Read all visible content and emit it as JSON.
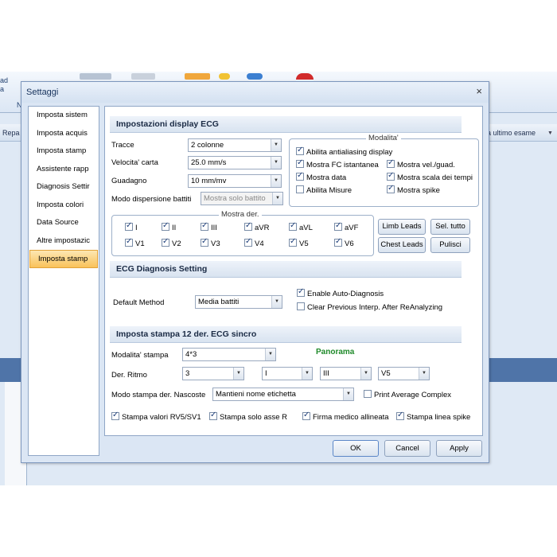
{
  "background": {
    "ribbon_left_label": "ad\na",
    "ribbon_n": "N",
    "toolbar_left": "Repa",
    "toolbar_right": "a ultimo esame"
  },
  "dialog": {
    "title": "Settaggi",
    "close_symbol": "×"
  },
  "nav": {
    "items": [
      "Imposta sistem",
      "Imposta acquis",
      "Imposta stamp",
      "Assistente rapp",
      "Diagnosis Settir",
      "Imposta colori",
      "Data Source",
      "Altre impostazic",
      "Imposta stamp"
    ],
    "active_index": 8
  },
  "display": {
    "header": "Impostazioni display  ECG",
    "tracce_label": "Tracce",
    "tracce_value": "2 colonne",
    "velocita_label": "Velocita' carta",
    "velocita_value": "25.0 mm/s",
    "guadagno_label": "Guadagno",
    "guadagno_value": "10 mm/mv",
    "modo_label": "Modo dispersione battiti",
    "modo_value": "Mostra solo battito",
    "modalita": {
      "title": "Modalita'",
      "items": [
        {
          "label": "Abilita antialiasing display",
          "checked": true
        },
        {
          "label": "Mostra FC istantanea",
          "checked": true
        },
        {
          "label": "Mostra vel./guad.",
          "checked": true
        },
        {
          "label": "Mostra data",
          "checked": true
        },
        {
          "label": "Mostra scala dei tempi",
          "checked": true
        },
        {
          "label": "Abilita Misure",
          "checked": false
        },
        {
          "label": "Mostra spike",
          "checked": true
        }
      ]
    },
    "mostra_der": {
      "title": "Mostra der.",
      "leads": [
        "I",
        "II",
        "III",
        "aVR",
        "aVL",
        "aVF",
        "V1",
        "V2",
        "V3",
        "V4",
        "V5",
        "V6"
      ]
    },
    "buttons": {
      "limb_leads": "Limb Leads",
      "sel_tutto": "Sel. tutto",
      "chest_leads": "Chest Leads",
      "pulisci": "Pulisci"
    }
  },
  "diagnosis": {
    "header": "ECG Diagnosis Setting",
    "default_method_label": "Default Method",
    "default_method_value": "Media battiti",
    "enable_auto": "Enable Auto-Diagnosis",
    "enable_auto_checked": true,
    "clear_previous": "Clear Previous Interp. After ReAnalyzing",
    "clear_previous_checked": false
  },
  "print": {
    "header": "Imposta stampa 12 der. ECG sincro",
    "modalita_label": "Modalita' stampa",
    "modalita_value": "4*3",
    "panorama": "Panorama",
    "der_ritmo_label": "Der. Ritmo",
    "der_ritmo_values": [
      "3",
      "I",
      "III",
      "V5"
    ],
    "modo_nascoste_label": "Modo stampa der. Nascoste",
    "modo_nascoste_value": "Mantieni nome etichetta",
    "print_average": "Print Average Complex",
    "print_average_checked": false,
    "bottom_checks": [
      {
        "label": "Stampa valori RV5/SV1",
        "checked": true
      },
      {
        "label": "Stampa solo asse R",
        "checked": true
      },
      {
        "label": "Firma medico allineata",
        "checked": true
      },
      {
        "label": "Stampa linea spike",
        "checked": true
      }
    ]
  },
  "footer": {
    "ok": "OK",
    "cancel": "Cancel",
    "apply": "Apply"
  }
}
